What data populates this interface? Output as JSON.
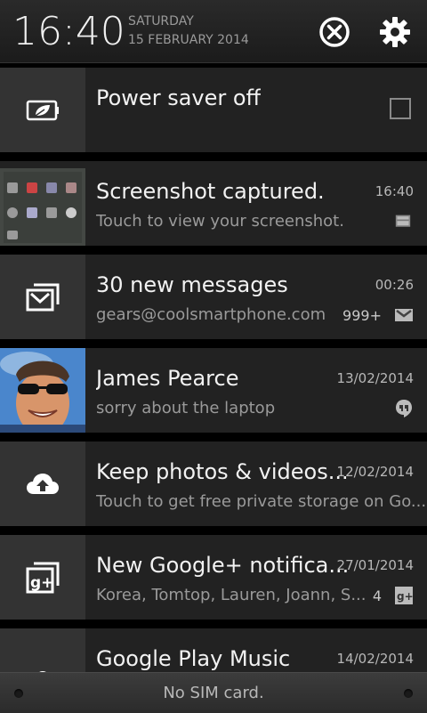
{
  "header": {
    "time": "16:40",
    "day": "SATURDAY",
    "date": "15 FEBRUARY 2014"
  },
  "notifications": [
    {
      "title": "Power saver off",
      "icon": "power-saver-leaf-icon",
      "checkbox": false
    },
    {
      "title": "Screenshot captured.",
      "subtitle": "Touch to view your screenshot.",
      "time": "16:40",
      "small_icon": "image-icon"
    },
    {
      "title": "30 new messages",
      "subtitle": "gears@coolsmartphone.com",
      "time": "00:26",
      "count": "999+",
      "small_icon": "gmail-icon"
    },
    {
      "title": "James Pearce",
      "subtitle": "sorry about the laptop",
      "time": "13/02/2014",
      "small_icon": "hangouts-icon"
    },
    {
      "title": "Keep photos & videos...",
      "subtitle": "Touch to get free private storage on Go...",
      "time": "12/02/2014",
      "icon": "cloud-upload-icon"
    },
    {
      "title": "New Google+ notifica...",
      "subtitle": "Korea, Tomtop, Lauren, Joann, S...",
      "time": "27/01/2014",
      "count": "4",
      "small_icon": "google-plus-icon"
    },
    {
      "title": "Google Play Music",
      "time": "14/02/2014",
      "icon": "play-store-icon"
    }
  ],
  "bottom": {
    "status": "No SIM card."
  },
  "colors": {
    "background": "#000000",
    "card": "#222222",
    "icon_box": "#333333",
    "secondary_text": "#9a9a9a"
  }
}
